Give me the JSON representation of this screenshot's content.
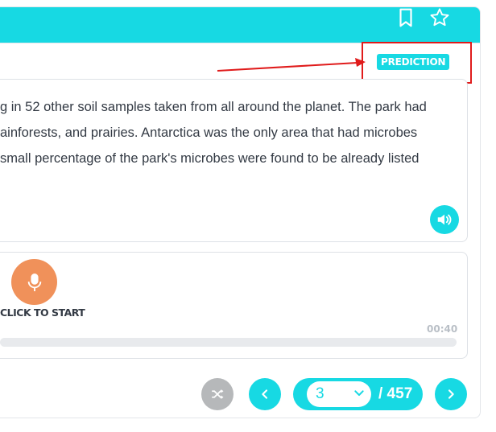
{
  "header": {
    "accent_color": "#17d9e3",
    "bookmark_icon": "bookmark-icon",
    "star_icon": "star-icon"
  },
  "badge": {
    "label": "PREDICTION"
  },
  "passage": {
    "lines": [
      "g in 52 other soil samples taken from all around the planet. The park had",
      "ainforests, and prairies. Antarctica was the only area that had microbes",
      "small percentage of the park's microbes were found to be already listed"
    ]
  },
  "recorder": {
    "start_label": "CLICK TO START",
    "timer": "00:40",
    "progress": 0
  },
  "pagination": {
    "current": "3",
    "total": "/ 457"
  },
  "colors": {
    "record": "#f0915a",
    "shuffle": "#b6b8ba",
    "annotation": "#e01b1b"
  }
}
